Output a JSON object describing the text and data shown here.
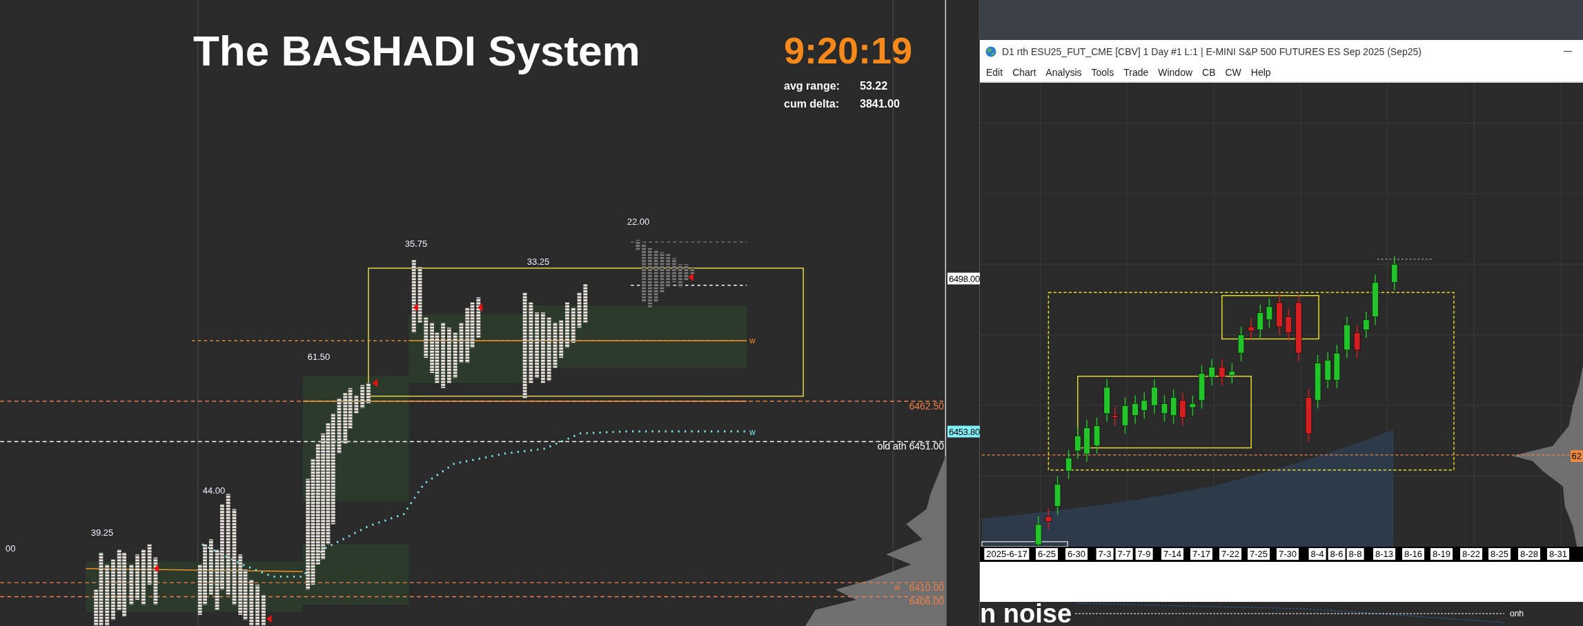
{
  "header": {
    "title": "The BASHADI System",
    "clock": "9:20:19",
    "stats": [
      {
        "label": "avg range:",
        "value": "53.22"
      },
      {
        "label": "cum delta:",
        "value": "3841.00"
      }
    ]
  },
  "profile_chart": {
    "range_labels": [
      "22.00",
      "35.75",
      "33.25",
      "61.50",
      "44.00",
      "39.25",
      "00"
    ],
    "level_labels": [
      {
        "text": "6462.50",
        "color": "#f0804a"
      },
      {
        "text": "old ath 6451.00",
        "color": "#ffffff"
      },
      {
        "text": "6410.00",
        "color": "#f0804a"
      },
      {
        "text": "6406.00",
        "color": "#f0804a"
      }
    ],
    "markers": [
      {
        "text": "w",
        "color": "#f0902a"
      },
      {
        "text": "w",
        "color": "#7fe8f0"
      },
      {
        "text": "w",
        "color": "#f0804a"
      }
    ]
  },
  "price_axis": {
    "tags": [
      {
        "text": "6498.00",
        "color": "#ffffff"
      },
      {
        "text": "6453.80",
        "color": "#7ff0f8"
      }
    ]
  },
  "window": {
    "title": "D1 rth ESU25_FUT_CME [CBV]  1 Day  #1 L:1 | E-MINI S&P 500 FUTURES ES Sep 2025 (Sep25)",
    "menu": [
      "Edit",
      "Chart",
      "Analysis",
      "Tools",
      "Trade",
      "Window",
      "CB",
      "CW",
      "Help"
    ],
    "price_tag": "62",
    "date_axis": [
      "2025-6-17",
      "6-25",
      "6-30",
      "7-3",
      "7-7",
      "7-9",
      "7-14",
      "7-17",
      "7-22",
      "7-25",
      "7-30",
      "8-4",
      "8-6",
      "8-8",
      "8-13",
      "8-16",
      "8-19",
      "8-22",
      "8-25",
      "8-28",
      "8-31"
    ]
  },
  "lower_panel": {
    "heading": "n noise",
    "line_label": "onh"
  }
}
